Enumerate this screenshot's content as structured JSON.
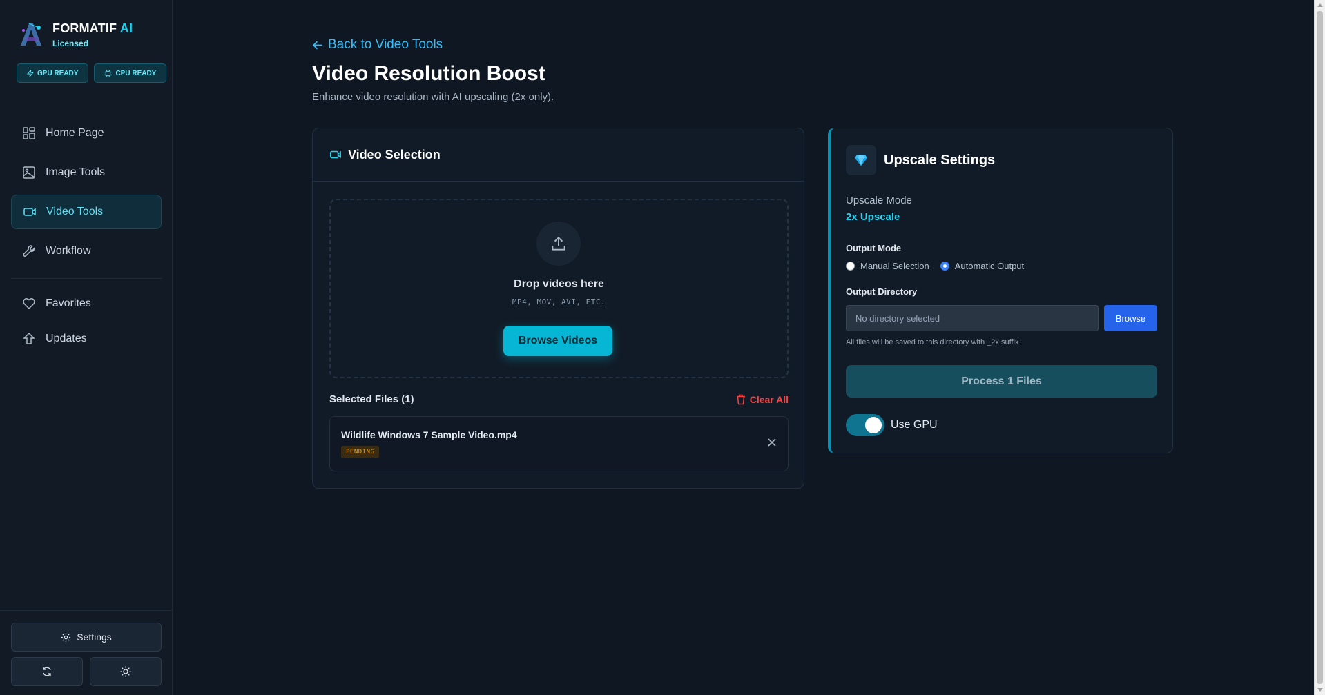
{
  "brand": {
    "name_main": "FORMATIF",
    "name_accent": " AI",
    "license": "Licensed"
  },
  "badges": [
    {
      "label": "GPU READY",
      "icon": "bolt-icon"
    },
    {
      "label": "CPU READY",
      "icon": "chip-icon"
    }
  ],
  "nav": {
    "items": [
      {
        "label": "Home Page",
        "icon": "grid-icon",
        "active": false
      },
      {
        "label": "Image Tools",
        "icon": "image-icon",
        "active": false
      },
      {
        "label": "Video Tools",
        "icon": "video-camera-icon",
        "active": true
      },
      {
        "label": "Workflow",
        "icon": "wrench-icon",
        "active": false
      }
    ],
    "secondary": [
      {
        "label": "Favorites",
        "icon": "heart-icon"
      },
      {
        "label": "Updates",
        "icon": "arrow-up-icon"
      }
    ]
  },
  "sidebar_bottom": {
    "settings_label": "Settings",
    "refresh_icon": "refresh-icon",
    "theme_icon": "sun-icon"
  },
  "page": {
    "back_link": "Back to Video Tools",
    "title": "Video Resolution Boost",
    "subtitle": "Enhance video resolution with AI upscaling (2x only)."
  },
  "video_selection": {
    "title": "Video Selection",
    "drop_title": "Drop videos here",
    "drop_formats": "MP4, MOV, AVI, ETC.",
    "browse_label": "Browse Videos",
    "selected_title": "Selected Files (1)",
    "clear_all_label": "Clear All",
    "files": [
      {
        "name": "Wildlife Windows 7 Sample Video.mp4",
        "status": "PENDING"
      }
    ]
  },
  "upscale_settings": {
    "title": "Upscale Settings",
    "mode_label": "Upscale Mode",
    "mode_value": "2x Upscale",
    "output_mode_label": "Output Mode",
    "output_options": [
      {
        "label": "Manual Selection",
        "selected": false
      },
      {
        "label": "Automatic Output",
        "selected": true
      }
    ],
    "output_dir_label": "Output Directory",
    "output_dir_placeholder": "No directory selected",
    "browse_label": "Browse",
    "hint": "All files will be saved to this directory with _2x suffix",
    "process_label": "Process 1 Files",
    "gpu_label": "Use GPU",
    "gpu_enabled": true
  },
  "colors": {
    "accent": "#22d3ee",
    "background": "#0f1722",
    "danger": "#ef4444",
    "primary_button": "#2563eb"
  }
}
